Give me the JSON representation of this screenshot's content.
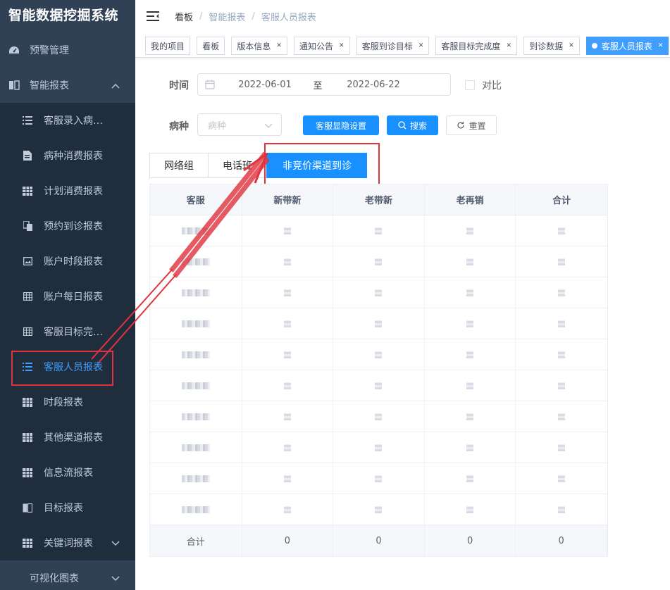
{
  "app": {
    "title": "智能数据挖掘系统"
  },
  "sidebar": {
    "top_items": [
      {
        "label": "预警管理",
        "icon": "dashboard-icon"
      },
      {
        "label": "智能报表",
        "icon": "book-icon"
      }
    ],
    "sub_items": [
      {
        "label": "客服录入病…",
        "icon": "list-icon"
      },
      {
        "label": "病种消费报表",
        "icon": "document-icon"
      },
      {
        "label": "计划消费报表",
        "icon": "grid-icon"
      },
      {
        "label": "预约到诊报表",
        "icon": "copy-icon"
      },
      {
        "label": "账户时段报表",
        "icon": "image-icon"
      },
      {
        "label": "账户每日报表",
        "icon": "table-icon"
      },
      {
        "label": "客服目标完…",
        "icon": "table-icon"
      },
      {
        "label": "客服人员报表",
        "icon": "list-icon"
      },
      {
        "label": "时段报表",
        "icon": "grid-icon"
      },
      {
        "label": "其他渠道报表",
        "icon": "grid-icon"
      },
      {
        "label": "信息流报表",
        "icon": "grid-icon"
      },
      {
        "label": "目标报表",
        "icon": "book-icon"
      },
      {
        "label": "关键词报表",
        "icon": "grid-icon"
      }
    ],
    "bottom_item": {
      "label": "可视化图表"
    }
  },
  "breadcrumb": [
    "看板",
    "智能报表",
    "客服人员报表"
  ],
  "tags": [
    {
      "label": "我的项目",
      "closable": false
    },
    {
      "label": "看板",
      "closable": false
    },
    {
      "label": "版本信息",
      "closable": true
    },
    {
      "label": "通知公告",
      "closable": true
    },
    {
      "label": "客服到诊目标",
      "closable": true
    },
    {
      "label": "客服目标完成度",
      "closable": true
    },
    {
      "label": "到诊数据",
      "closable": true
    },
    {
      "label": "客服人员报表",
      "closable": true
    }
  ],
  "filters": {
    "time_label": "时间",
    "start_date": "2022-06-01",
    "range_separator": "至",
    "end_date": "2022-06-22",
    "compare_label": "对比",
    "disease_label": "病种",
    "disease_placeholder": "病种",
    "settings_button": "客服显隐设置",
    "search_button": "搜索",
    "reset_button": "重置"
  },
  "tabs": [
    "网络组",
    "电话班",
    "非竞价渠道到诊"
  ],
  "table": {
    "headers": [
      "客服",
      "新带新",
      "老带新",
      "老再销",
      "合计"
    ],
    "row_count": 10,
    "footer": [
      "合计",
      "0",
      "0",
      "0",
      "0"
    ]
  },
  "colors": {
    "sidebar_bg": "#304156",
    "submenu_bg": "#1f2d3d",
    "accent": "#1890ff",
    "annotation_red": "#e0333d"
  }
}
